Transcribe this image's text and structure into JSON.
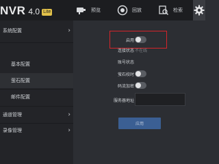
{
  "brand": {
    "name": "NVR",
    "version": "4.0",
    "badge": "Lite"
  },
  "topnav": [
    {
      "label": "预览",
      "icon": "camera-icon"
    },
    {
      "label": "回放",
      "icon": "playback-icon"
    },
    {
      "label": "检索",
      "icon": "search-icon"
    },
    {
      "label": "",
      "icon": "gear-icon"
    }
  ],
  "sidebar": {
    "items": [
      {
        "label": "系统配置",
        "chevron": "›"
      },
      {
        "label": "基本配置"
      },
      {
        "label": "萤石配置"
      },
      {
        "label": "邮件配置"
      },
      {
        "label": "通道管理",
        "chevron": "›"
      },
      {
        "label": "录像管理",
        "chevron": "›"
      }
    ]
  },
  "form": {
    "enable_label": "启用",
    "enable_on": false,
    "conn_status_label": "连接状态",
    "conn_status_value": "不在线",
    "account_status_label": "账号状态",
    "timesync_label": "萤石校时",
    "timesync_on": false,
    "encrypt_label": "码流加密",
    "encrypt_on": false,
    "server_label": "服务器地址",
    "server_value": "",
    "apply_label": "应用"
  },
  "colors": {
    "highlight": "#d6242a",
    "apply_button": "#3b5f93",
    "badge": "#e3c24a"
  }
}
